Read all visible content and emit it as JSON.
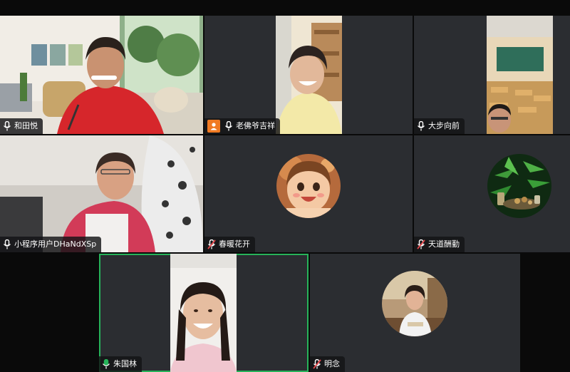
{
  "participants": [
    {
      "name": "和田悦",
      "mic": "on"
    },
    {
      "name": "老佛爷吉祥",
      "mic": "on",
      "host": true
    },
    {
      "name": "大步向前",
      "mic": "on"
    },
    {
      "name": "小程序用户DHaNdXSp",
      "mic": "on"
    },
    {
      "name": "春暖花开",
      "mic": "muted"
    },
    {
      "name": "天道酬勤",
      "mic": "muted"
    },
    {
      "name": "朱国林",
      "mic": "on",
      "active_speaker": true
    },
    {
      "name": "明念",
      "mic": "muted"
    }
  ],
  "colors": {
    "tile_bg": "#2b2d31",
    "active_speaker_border": "#27b35a",
    "mic_on": "#ffffff",
    "mic_muted": "#e5484d",
    "host_badge": "#f07a22"
  },
  "icons": {
    "mic_on": "microphone-icon",
    "mic_muted": "microphone-muted-icon",
    "host": "user-host-icon"
  }
}
